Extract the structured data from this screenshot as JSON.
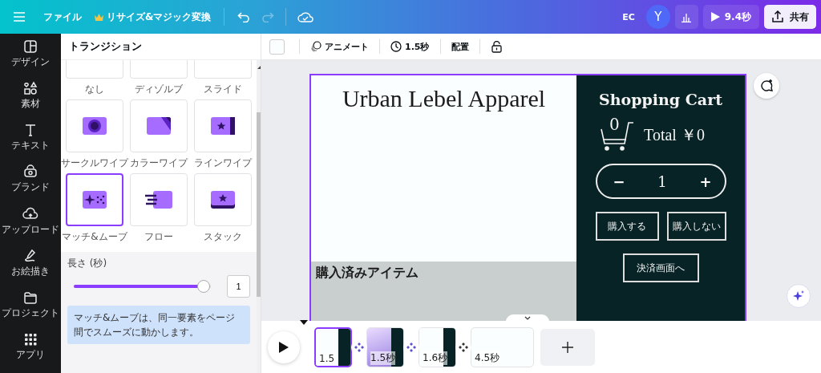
{
  "topbar": {
    "file_menu": "ファイル",
    "resize_button": "リサイズ&マジック変換",
    "undo_enabled": true,
    "redo_enabled": false,
    "workspace_name": "EC",
    "avatar_initial": "Y",
    "play_button": "9.4秒",
    "share_button": "共有"
  },
  "sidebar": {
    "items": [
      {
        "label": "デザイン",
        "kind": "design"
      },
      {
        "label": "素材",
        "kind": "elements"
      },
      {
        "label": "テキスト",
        "kind": "text"
      },
      {
        "label": "ブランド",
        "kind": "brand"
      },
      {
        "label": "アップロード",
        "kind": "uploads"
      },
      {
        "label": "お絵描き",
        "kind": "draw"
      },
      {
        "label": "プロジェクト",
        "kind": "projects"
      },
      {
        "label": "アプリ",
        "kind": "apps"
      }
    ]
  },
  "panel": {
    "title": "トランジション",
    "transitions": [
      {
        "label": "なし",
        "kind": "none",
        "selected": false
      },
      {
        "label": "ディゾルブ",
        "kind": "dissolve",
        "selected": false
      },
      {
        "label": "スライド",
        "kind": "slide",
        "selected": false
      },
      {
        "label": "サークルワイプ",
        "kind": "circle-wipe",
        "selected": false
      },
      {
        "label": "カラーワイプ",
        "kind": "color-wipe",
        "selected": false
      },
      {
        "label": "ラインワイプ",
        "kind": "line-wipe",
        "selected": false
      },
      {
        "label": "マッチ&ムーブ",
        "kind": "match-move",
        "selected": true
      },
      {
        "label": "フロー",
        "kind": "flow",
        "selected": false
      },
      {
        "label": "スタック",
        "kind": "stack",
        "selected": false
      }
    ],
    "duration": {
      "label": "長さ (秒)",
      "level": 0.95,
      "value": "1"
    },
    "info": "マッチ&ムーブは、同一要素をページ間でスムーズに動かします。"
  },
  "toolbar": {
    "animate_button": "アニメート",
    "duration_button": "1.5秒",
    "position_button": "配置"
  },
  "page": {
    "title": "Urban Lebel Apparel",
    "purchased_label": "購入済みアイテム",
    "cart_title": "Shopping Cart",
    "cart_count": "0",
    "total": "Total ￥0",
    "quantity": {
      "minus": "−",
      "value": "1",
      "plus": "+"
    },
    "buttons": [
      "購入する",
      "購入しない"
    ],
    "checkout_button": "決済画面へ"
  },
  "timeline": {
    "pages": [
      {
        "duration": "1.5",
        "selected": true,
        "kind": "cart"
      },
      {
        "duration": "1.5秒",
        "selected": false,
        "kind": "gradient"
      },
      {
        "duration": "1.6秒",
        "selected": false,
        "kind": "cart"
      },
      {
        "duration": "4.5秒",
        "selected": false,
        "kind": "blank"
      }
    ]
  }
}
